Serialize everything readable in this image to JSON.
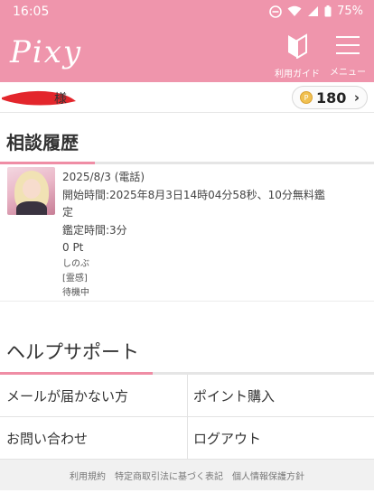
{
  "status_bar": {
    "time": "16:05",
    "battery": "75%"
  },
  "header": {
    "logo": "Pixy",
    "guide_label": "利用ガイド",
    "menu_label": "メニュー"
  },
  "user": {
    "name_suffix": "様",
    "points": "180"
  },
  "history": {
    "title": "相談履歴",
    "items": [
      {
        "date": "2025/8/3 (電話)",
        "start_time": "開始時間:2025年8月3日14時04分58秒、10分無料鑑定",
        "duration": "鑑定時間:3分",
        "points": "0 Pt",
        "name": "しのぶ",
        "category": "[霊感]",
        "status": "待機中"
      }
    ]
  },
  "help": {
    "title": "ヘルプサポート",
    "links": [
      "メールが届かない方",
      "ポイント購入",
      "お問い合わせ",
      "ログアウト"
    ]
  },
  "footer": {
    "links": [
      "利用規約",
      "特定商取引法に基づく表記",
      "個人情報保護方針"
    ]
  },
  "colors": {
    "brand_pink": "#ef95ac",
    "accent_pink": "#ef8da5"
  }
}
